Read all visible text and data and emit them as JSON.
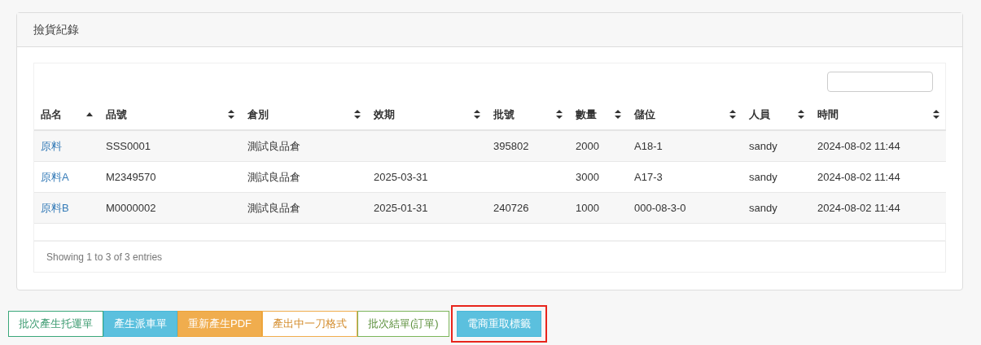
{
  "panel": {
    "title": "撿貨紀錄"
  },
  "table": {
    "columns": [
      {
        "label": "品名",
        "sorted": true
      },
      {
        "label": "品號",
        "sorted": false
      },
      {
        "label": "倉別",
        "sorted": false
      },
      {
        "label": "效期",
        "sorted": false
      },
      {
        "label": "批號",
        "sorted": false
      },
      {
        "label": "數量",
        "sorted": false
      },
      {
        "label": "儲位",
        "sorted": false
      },
      {
        "label": "人員",
        "sorted": false
      },
      {
        "label": "時間",
        "sorted": false
      }
    ],
    "rows": [
      [
        "原料",
        "SSS0001",
        "測試良品倉",
        "",
        "395802",
        "2000",
        "A18-1",
        "sandy",
        "2024-08-02 11:44"
      ],
      [
        "原料A",
        "M2349570",
        "測試良品倉",
        "2025-03-31",
        "",
        "3000",
        "A17-3",
        "sandy",
        "2024-08-02 11:44"
      ],
      [
        "原料B",
        "M0000002",
        "測試良品倉",
        "2025-01-31",
        "240726",
        "1000",
        "000-08-3-0",
        "sandy",
        "2024-08-02 11:44"
      ]
    ]
  },
  "info": "Showing 1 to 3 of 3 entries",
  "buttons": [
    {
      "label": "批次產生托運單",
      "kind": "outline-green",
      "highlighted": false
    },
    {
      "label": "產生派車單",
      "kind": "info",
      "highlighted": false
    },
    {
      "label": "重新產生PDF",
      "kind": "warning",
      "highlighted": false
    },
    {
      "label": "產出中一刀格式",
      "kind": "outline-orange",
      "highlighted": false
    },
    {
      "label": "批次結單(訂單)",
      "kind": "outline-lime",
      "highlighted": false
    },
    {
      "label": "電商重取標籤",
      "kind": "info",
      "highlighted": true
    }
  ]
}
